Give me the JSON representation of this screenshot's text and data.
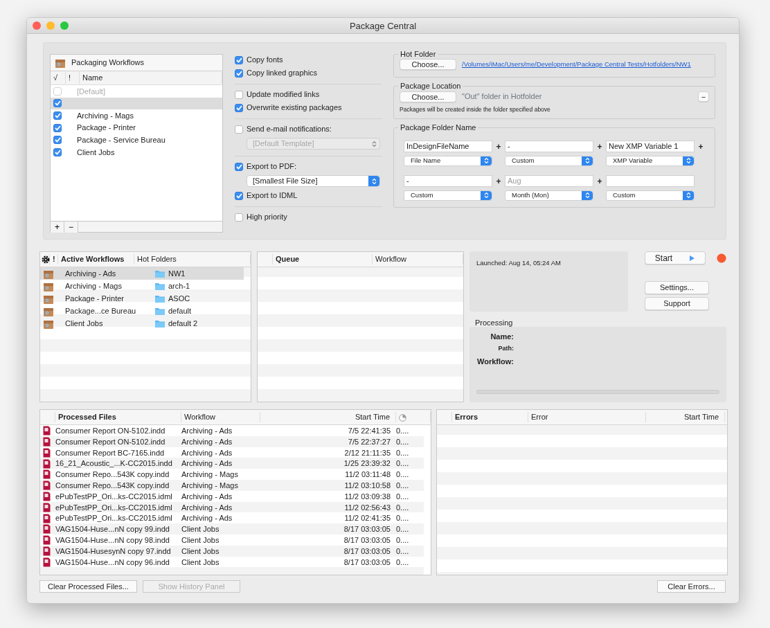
{
  "window": {
    "title": "Package Central"
  },
  "workflows": {
    "title": "Packaging Workflows",
    "columns": [
      "√",
      "!",
      "Name"
    ],
    "rows": [
      {
        "name": "[Default]",
        "checked": false,
        "disabled": true,
        "selected": false
      },
      {
        "checked": true,
        "disabled": false,
        "selected": true
      },
      {
        "name": "Archiving - Mags",
        "checked": true,
        "disabled": false,
        "selected": false
      },
      {
        "name": "Package - Printer",
        "checked": true,
        "disabled": false,
        "selected": false
      },
      {
        "name": "Package - Service Bureau",
        "checked": true,
        "disabled": false,
        "selected": false
      },
      {
        "name": "Client Jobs",
        "checked": true,
        "disabled": false,
        "selected": false
      }
    ],
    "buttons": [
      "+",
      "−"
    ]
  },
  "option_groups": [
    [
      {
        "kind": "checkbox",
        "label": "Copy fonts",
        "checked": true
      },
      {
        "kind": "checkbox",
        "label": "Copy linked graphics",
        "checked": true
      }
    ],
    [
      {
        "kind": "checkbox",
        "label": "Update modified links",
        "checked": false
      },
      {
        "kind": "checkbox",
        "label": "Overwrite existing packages",
        "checked": true
      }
    ],
    [
      {
        "kind": "checkbox",
        "label": "Send e-mail notifications:",
        "checked": false
      },
      {
        "kind": "popup",
        "value": "[Default Template]",
        "disabled": true
      }
    ],
    [
      {
        "kind": "checkbox",
        "label": "Export to PDF:",
        "checked": true
      },
      {
        "kind": "popup",
        "value": "[Smallest File Size]",
        "disabled": false
      },
      {
        "kind": "checkbox",
        "label": "Export to IDML",
        "checked": true
      }
    ],
    [
      {
        "kind": "checkbox",
        "label": "High priority",
        "checked": false
      }
    ]
  ],
  "hot_folder": {
    "title": "Hot Folder",
    "button": "Choose...",
    "path": "/Volumes/iMac/Users/me/Development/Package Central Tests/Hotfolders/NW1"
  },
  "package_location": {
    "title": "Package Location",
    "button": "Choose...",
    "path": "\"Out\" folder in Hotfolder",
    "remove_button": "−",
    "note": "Packages will be created inside the folder specified above"
  },
  "folder_name": {
    "title": "Package Folder Name",
    "rows": [
      [
        {
          "value": "InDesignFileName",
          "type": "File Name",
          "plus": "+"
        },
        {
          "value": "-",
          "type": "Custom",
          "plus": "+"
        },
        {
          "value": "New XMP Variable 1",
          "type": "XMP Variable",
          "plus": "+"
        }
      ],
      [
        {
          "value": "-",
          "type": "Custom",
          "plus": "+"
        },
        {
          "placeholder": "Aug",
          "type": "Month (Mon)",
          "plus": "+"
        },
        {
          "type": "Custom"
        }
      ]
    ]
  },
  "active_workflows": {
    "columns": [
      "!",
      "Active Workflows",
      "Hot Folders"
    ],
    "rows": [
      {
        "name": "Archiving - Ads",
        "folder": "NW1",
        "selected": true
      },
      {
        "name": "Archiving - Mags",
        "folder": "arch-1",
        "selected": false
      },
      {
        "name": "Package - Printer",
        "folder": "ASOC",
        "selected": false
      },
      {
        "name": "Package...ce Bureau",
        "folder": "default",
        "selected": false
      },
      {
        "name": "Client Jobs",
        "folder": "default 2",
        "selected": false
      }
    ]
  },
  "queue": {
    "columns": [
      "Queue",
      "Workflow"
    ]
  },
  "launched": "Launched: Aug 14, 05:24 AM",
  "controls": {
    "start": "Start",
    "settings": "Settings...",
    "support": "Support"
  },
  "processing": {
    "title": "Processing",
    "labels": [
      "Name:",
      "Path:",
      "Workflow:"
    ],
    "progress": {
      "level": 0
    }
  },
  "processed_files": {
    "columns": [
      "Processed Files",
      "Workflow",
      "Start Time"
    ],
    "rows": [
      {
        "file": "Consumer Report ON-5102.indd",
        "workflow": "Archiving - Ads",
        "start": "7/5 22:41:35",
        "column_4": "0...."
      },
      {
        "file": "Consumer Report ON-5102.indd",
        "workflow": "Archiving - Ads",
        "start": "7/5 22:37:27",
        "column_4": "0...."
      },
      {
        "file": "Consumer Report BC-7165.indd",
        "workflow": "Archiving - Ads",
        "start": "2/12 21:11:35",
        "column_4": "0...."
      },
      {
        "file": "16_21_Acoustic_...K-CC2015.indd",
        "workflow": "Archiving - Ads",
        "start": "1/25 23:39:32",
        "column_4": "0...."
      },
      {
        "file": "Consumer Repo...543K copy.indd",
        "workflow": "Archiving - Mags",
        "start": "11/2 03:11:48",
        "column_4": "0...."
      },
      {
        "file": "Consumer Repo...543K copy.indd",
        "workflow": "Archiving - Mags",
        "start": "11/2 03:10:58",
        "column_4": "0...."
      },
      {
        "file": "ePubTestPP_Ori...ks-CC2015.idml",
        "workflow": "Archiving - Ads",
        "start": "11/2 03:09:38",
        "column_4": "0...."
      },
      {
        "file": "ePubTestPP_Ori...ks-CC2015.idml",
        "workflow": "Archiving - Ads",
        "start": "11/2 02:56:43",
        "column_4": "0...."
      },
      {
        "file": "ePubTestPP_Ori...ks-CC2015.idml",
        "workflow": "Archiving - Ads",
        "start": "11/2 02:41:35",
        "column_4": "0...."
      },
      {
        "file": "VAG1504-Huse...nN copy 99.indd",
        "workflow": "Client Jobs",
        "start": "8/17 03:03:05",
        "column_4": "0...."
      },
      {
        "file": "VAG1504-Huse...nN copy 98.indd",
        "workflow": "Client Jobs",
        "start": "8/17 03:03:05",
        "column_4": "0...."
      },
      {
        "file": "VAG1504-HusesynN copy 97.indd",
        "workflow": "Client Jobs",
        "start": "8/17 03:03:05",
        "column_4": "0...."
      },
      {
        "file": "VAG1504-Huse...nN copy 96.indd",
        "workflow": "Client Jobs",
        "start": "8/17 03:03:05",
        "column_4": "0...."
      }
    ]
  },
  "errors": {
    "columns": [
      "Errors",
      "Error",
      "Start Time"
    ]
  },
  "bottom_buttons": [
    {
      "label": "Clear Processed Files...",
      "disabled": false
    },
    {
      "label": "Show History Panel",
      "disabled": true
    },
    {
      "label": "Clear Errors...",
      "disabled": false
    }
  ]
}
